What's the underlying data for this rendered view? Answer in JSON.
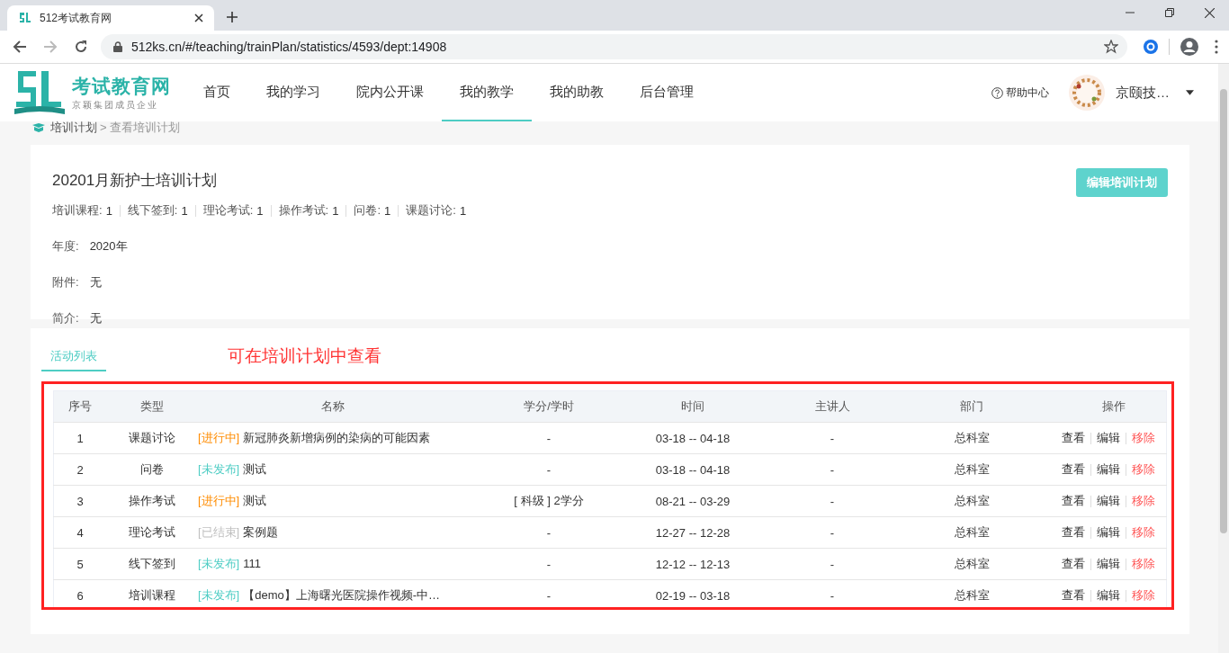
{
  "browser": {
    "tab_title": "512考试教育网",
    "url": "512ks.cn/#/teaching/trainPlan/statistics/4593/dept:14908"
  },
  "site_header": {
    "logo_text": "考试教育网",
    "logo_subtitle": "京颖集团成员企业",
    "nav": [
      {
        "label": "首页",
        "selected": false
      },
      {
        "label": "我的学习",
        "selected": false
      },
      {
        "label": "院内公开课",
        "selected": false
      },
      {
        "label": "我的教学",
        "selected": true
      },
      {
        "label": "我的助教",
        "selected": false
      },
      {
        "label": "后台管理",
        "selected": false
      }
    ],
    "help": "帮助中心",
    "user_name": "京颐技…"
  },
  "breadcrumb": [
    "培训计划",
    ">",
    "查看培训计划"
  ],
  "plan": {
    "title": "20201月新护士培训计划",
    "edit_button": "编辑培训计划",
    "stats": [
      {
        "label": "培训课程:",
        "value": "1"
      },
      {
        "label": "线下签到:",
        "value": "1"
      },
      {
        "label": "理论考试:",
        "value": "1"
      },
      {
        "label": "操作考试:",
        "value": "1"
      },
      {
        "label": "问卷:",
        "value": "1"
      },
      {
        "label": "课题讨论:",
        "value": "1"
      }
    ],
    "fields": [
      {
        "label": "年度:",
        "value": "2020年"
      },
      {
        "label": "附件:",
        "value": "无"
      },
      {
        "label": "简介:",
        "value": "无"
      }
    ]
  },
  "activities": {
    "tabs": [
      {
        "label": "活动列表",
        "selected": true
      }
    ],
    "annotation": "可在培训计划中查看",
    "columns": [
      "序号",
      "类型",
      "名称",
      "学分/学时",
      "时间",
      "主讲人",
      "部门",
      "操作"
    ],
    "rows": [
      {
        "index": "1",
        "type": "课题讨论",
        "status": {
          "label": "[进行中]",
          "kind": "ongoing"
        },
        "name": "新冠肺炎新增病例的染病的可能因素",
        "credit": "-",
        "time": "03-18 -- 04-18",
        "speaker": "-",
        "dept": "总科室",
        "actions": [
          "查看",
          "编辑",
          "移除"
        ]
      },
      {
        "index": "2",
        "type": "问卷",
        "status": {
          "label": "[未发布]",
          "kind": "unpublished"
        },
        "name": "测试",
        "credit": "-",
        "time": "03-18 -- 04-18",
        "speaker": "-",
        "dept": "总科室",
        "actions": [
          "查看",
          "编辑",
          "移除"
        ]
      },
      {
        "index": "3",
        "type": "操作考试",
        "status": {
          "label": "[进行中]",
          "kind": "ongoing"
        },
        "name": "测试",
        "credit": "[ 科级 ] 2学分",
        "time": "08-21 -- 03-29",
        "speaker": "-",
        "dept": "总科室",
        "actions": [
          "查看",
          "编辑",
          "移除"
        ]
      },
      {
        "index": "4",
        "type": "理论考试",
        "status": {
          "label": "[已结束]",
          "kind": "ended"
        },
        "name": "案例题",
        "credit": "-",
        "time": "12-27 -- 12-28",
        "speaker": "-",
        "dept": "总科室",
        "actions": [
          "查看",
          "编辑",
          "移除"
        ]
      },
      {
        "index": "5",
        "type": "线下签到",
        "status": {
          "label": "[未发布]",
          "kind": "unpublished"
        },
        "name": "111",
        "credit": "-",
        "time": "12-12 -- 12-13",
        "speaker": "-",
        "dept": "总科室",
        "actions": [
          "查看",
          "编辑",
          "移除"
        ]
      },
      {
        "index": "6",
        "type": "培训课程",
        "status": {
          "label": "[未发布]",
          "kind": "unpublished"
        },
        "name": "【demo】上海曙光医院操作视频-中…",
        "credit": "-",
        "time": "02-19 -- 03-18",
        "speaker": "-",
        "dept": "总科室",
        "actions": [
          "查看",
          "编辑",
          "移除"
        ]
      }
    ]
  }
}
